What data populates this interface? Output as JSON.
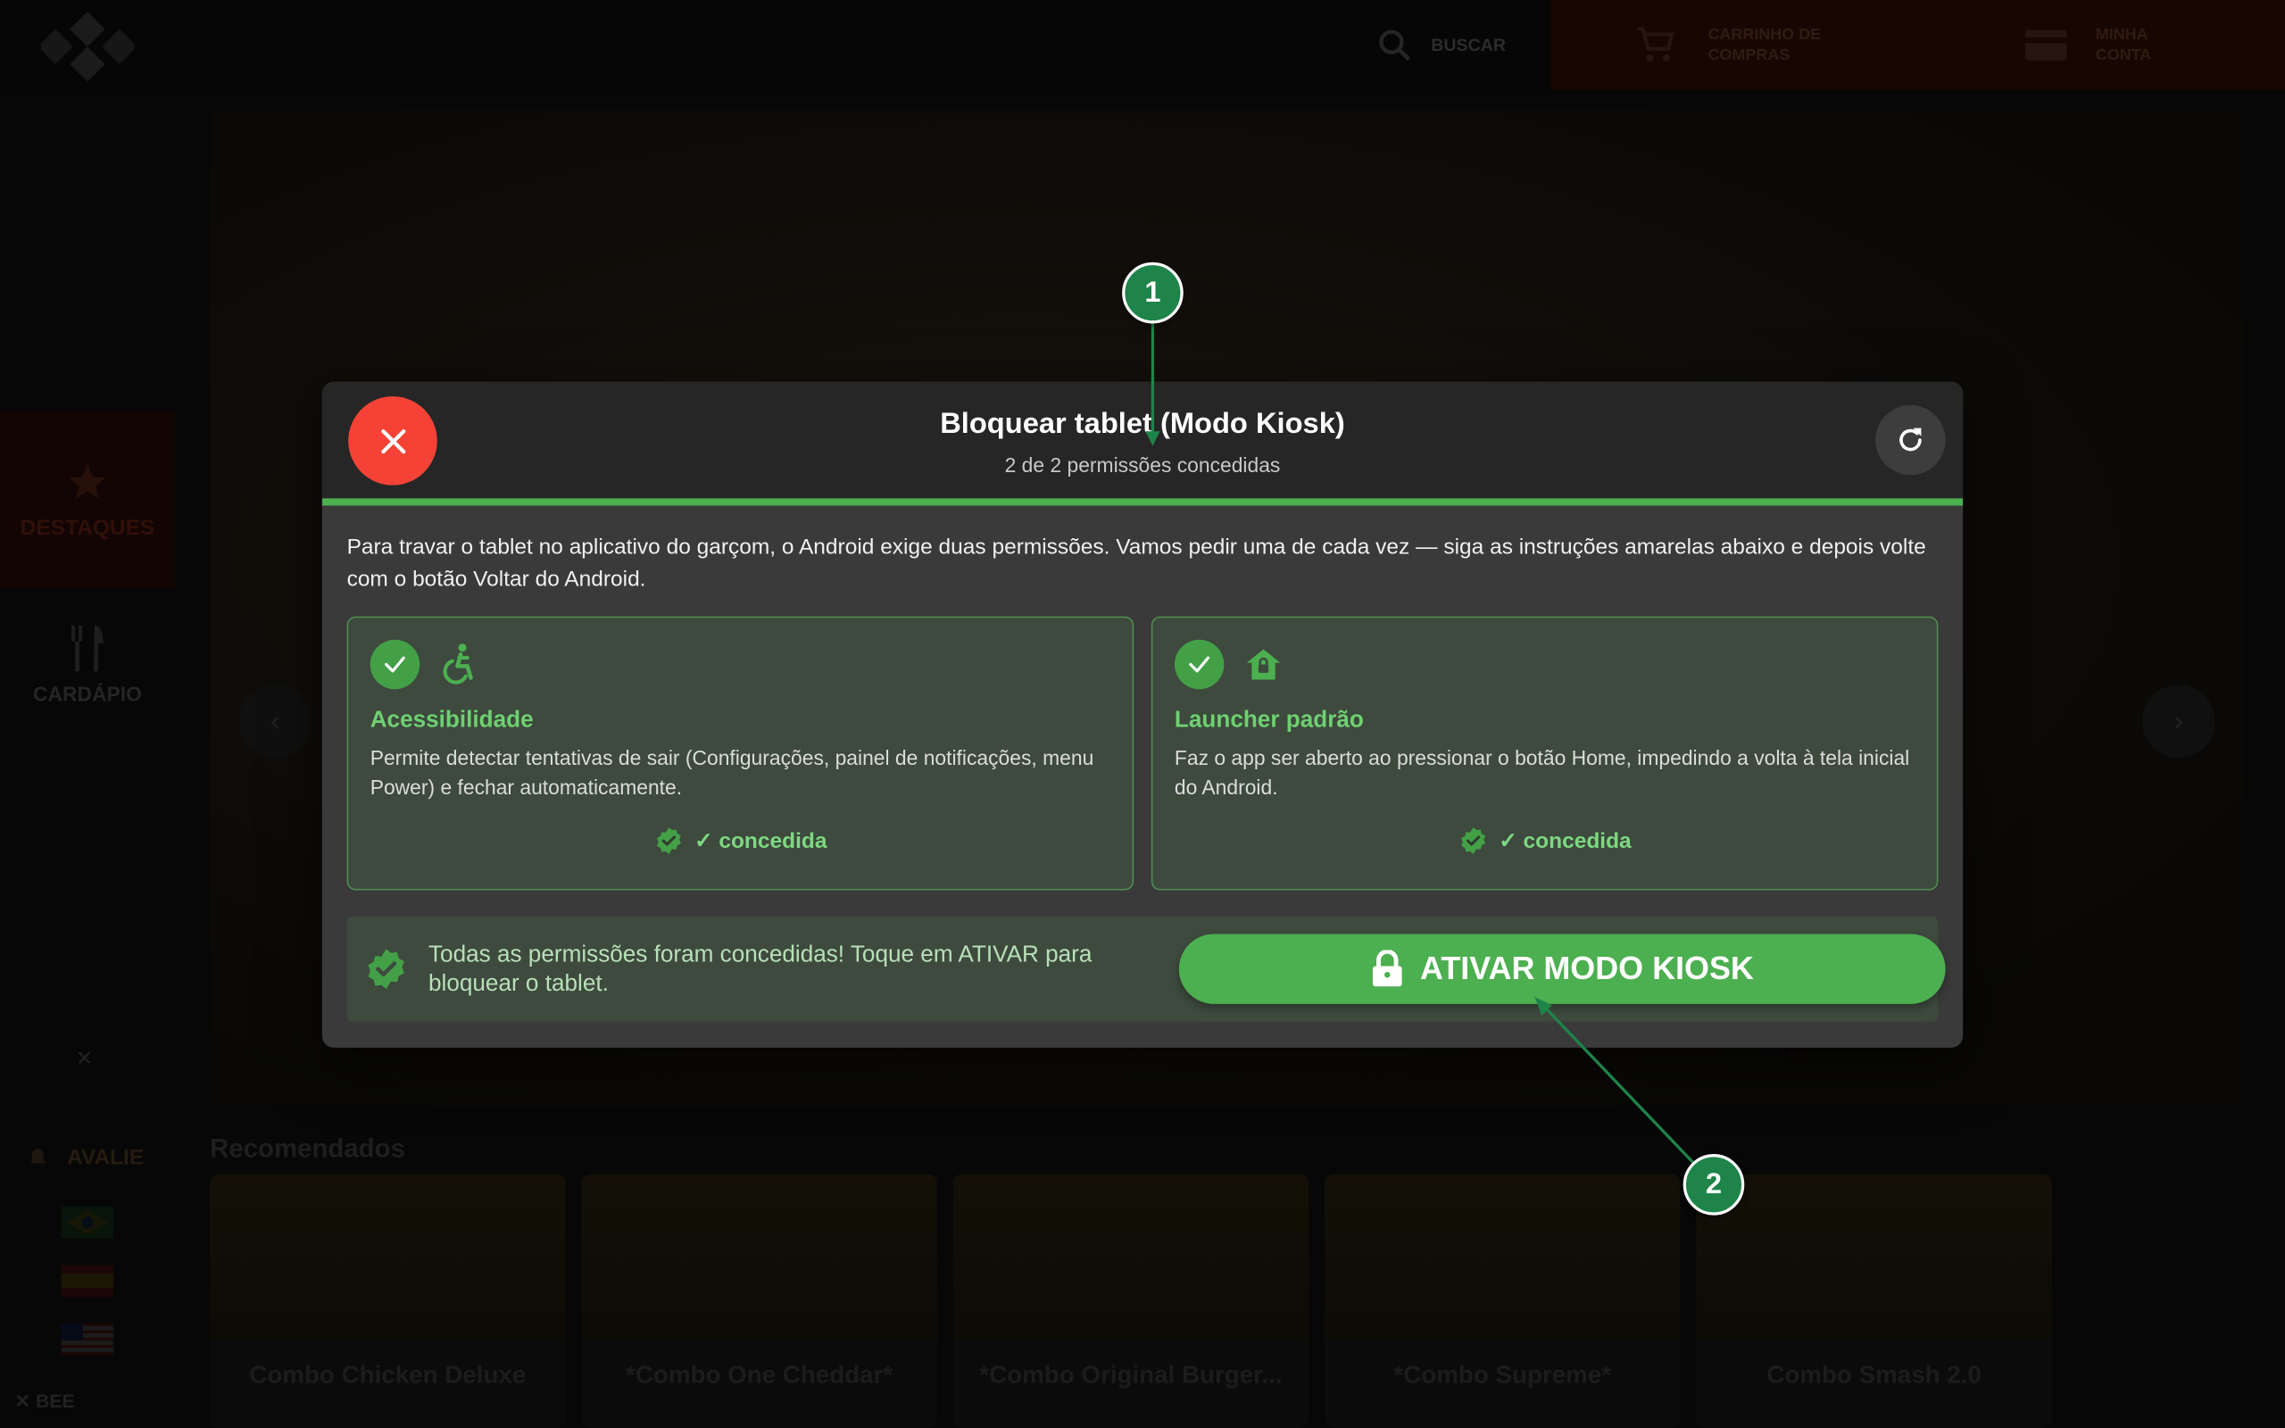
{
  "app": {
    "search_label": "BUSCAR",
    "cart_label": "CARRINHO DE COMPRAS",
    "account_label": "MINHA CONTA",
    "sidebar": {
      "featured_label": "DESTAQUES",
      "menu_label": "CARDÁPIO",
      "rate_label": "AVALIE",
      "brand_label": "BEE"
    },
    "recommended_title": "Recomendados",
    "products": [
      "Combo Chicken Deluxe",
      "*Combo One Cheddar*",
      "*Combo Original Burger...",
      "*Combo Supreme*",
      "Combo Smash 2.0"
    ]
  },
  "modal": {
    "title": "Bloquear tablet (Modo Kiosk)",
    "subtitle": "2 de 2 permissões concedidas",
    "progress_fraction": 1.0,
    "description": "Para travar o tablet no aplicativo do garçom, o Android exige duas permissões. Vamos pedir uma de cada vez — siga as instruções amarelas abaixo e depois volte com o botão Voltar do Android.",
    "permissions": [
      {
        "icon": "accessibility-icon",
        "title": "Acessibilidade",
        "text": "Permite detectar tentativas de sair (Configurações, painel de notificações, menu Power) e fechar automaticamente.",
        "status": "✓ concedida"
      },
      {
        "icon": "home-lock-icon",
        "title": "Launcher padrão",
        "text": "Faz o app ser aberto ao pressionar o botão Home, impedindo a volta à tela inicial do Android.",
        "status": "✓ concedida"
      }
    ],
    "footer_message": "Todas as permissões foram concedidas! Toque em ATIVAR para bloquear o tablet.",
    "activate_label": "ATIVAR MODO KIOSK"
  },
  "annotations": [
    "1",
    "2"
  ],
  "colors": {
    "success": "#4caf50",
    "danger": "#f44336",
    "marker": "#1e8449"
  }
}
